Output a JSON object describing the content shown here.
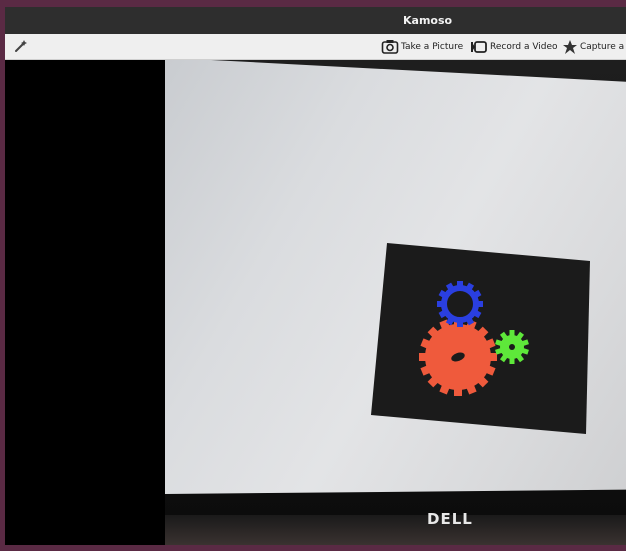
{
  "window": {
    "title": "Kamoso"
  },
  "toolbar": {
    "take_picture": "Take a Picture",
    "record_video": "Record a Video",
    "capture": "Capture a"
  },
  "scene": {
    "monitor_brand": "DELL"
  },
  "colors": {
    "gear_blue": "#2a3fe0",
    "gear_red": "#ef5a3c",
    "gear_green": "#5ee83a",
    "board": "#1b1b1b"
  }
}
